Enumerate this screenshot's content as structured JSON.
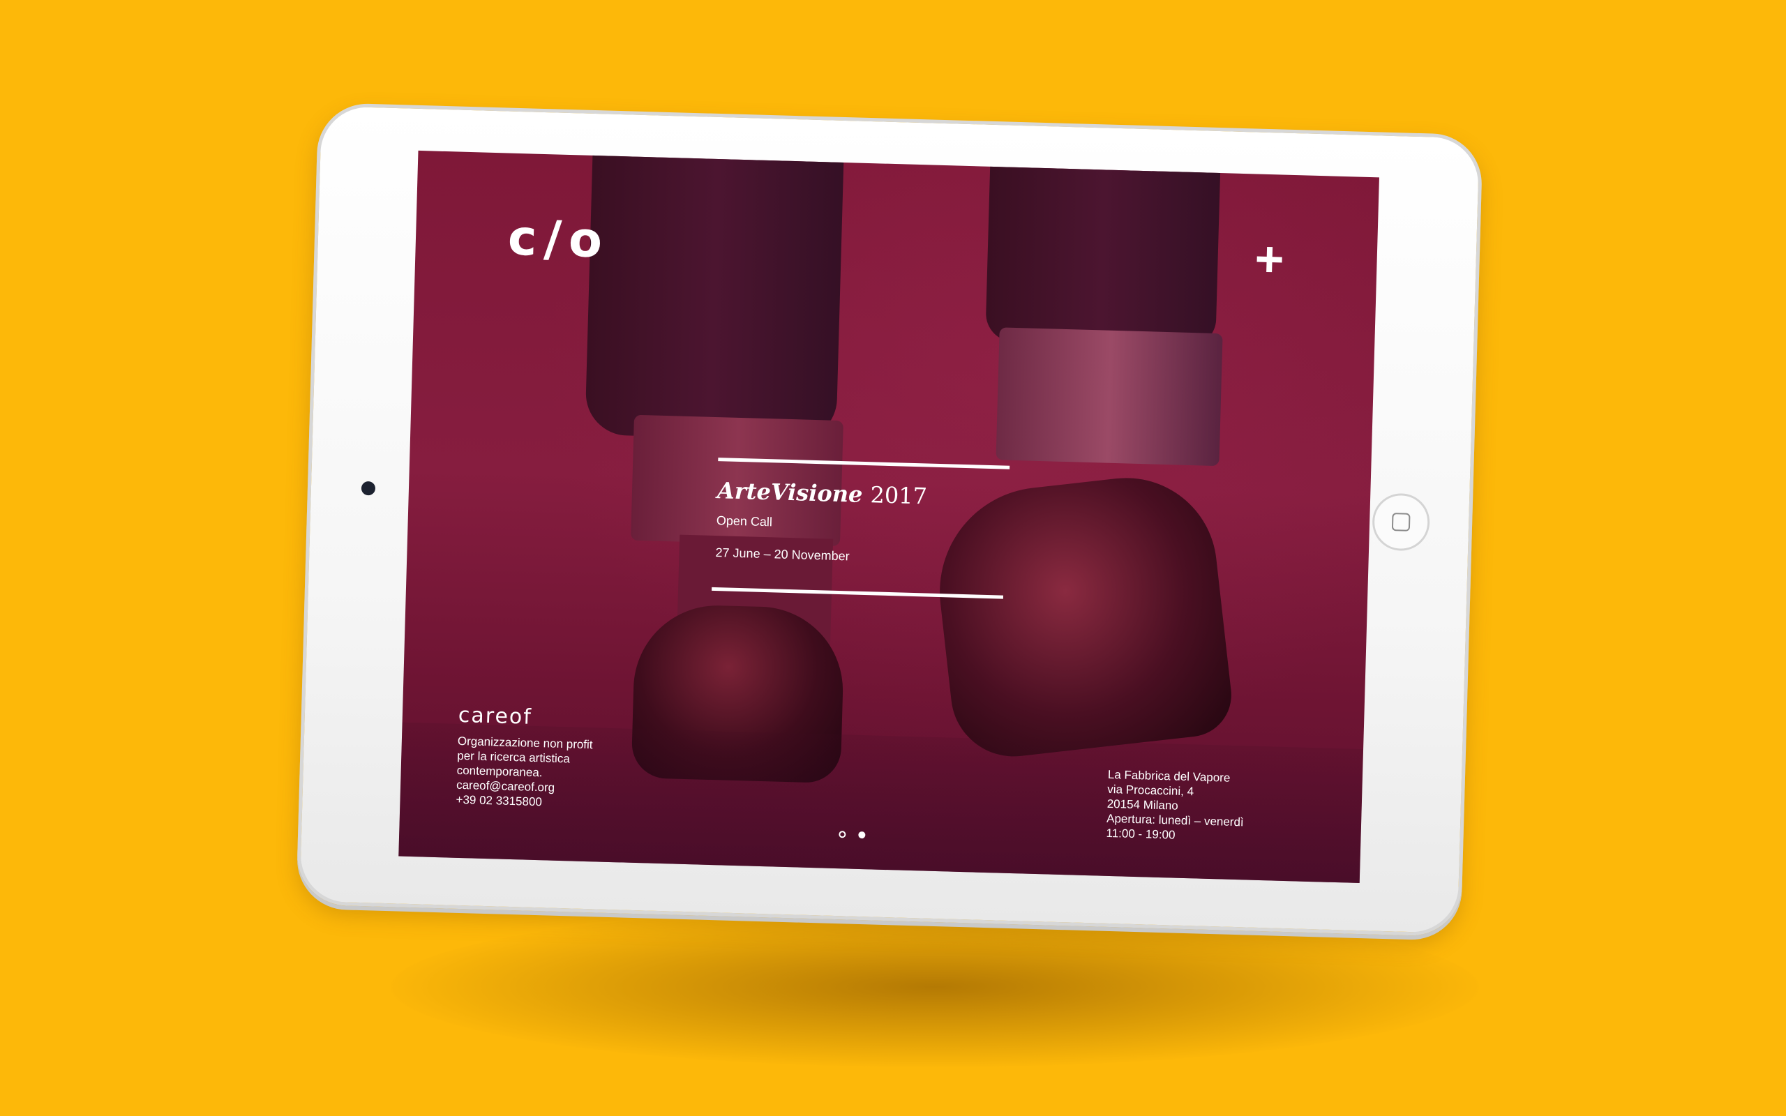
{
  "colors": {
    "background": "#FDB809",
    "screen_overlay": "#861D3F",
    "text": "#FFFFFF"
  },
  "header": {
    "logo_text": "c/o",
    "menu_icon": "plus-icon"
  },
  "event": {
    "title": "ArteVisione",
    "year": "2017",
    "subtitle": "Open Call",
    "dates": "27 June – 20 November"
  },
  "footer_left": {
    "brand": "careof",
    "lines": [
      "Organizzazione non profit",
      "per la ricerca artistica contemporanea.",
      "careof@careof.org",
      "+39 02 3315800"
    ]
  },
  "footer_right": {
    "lines": [
      "La Fabbrica del Vapore",
      "via Procaccini, 4",
      "20154 Milano",
      "Apertura: lunedì – venerdì",
      "11:00 - 19:00"
    ]
  },
  "pager": {
    "total": 2,
    "active": 2
  }
}
